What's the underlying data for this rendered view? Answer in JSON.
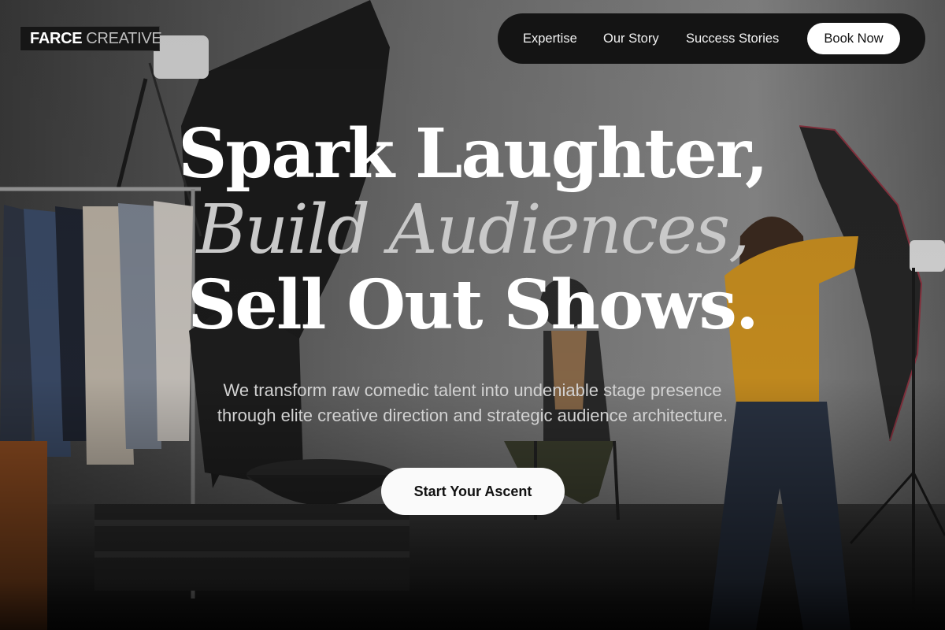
{
  "brand": {
    "logo_primary": "FARCE",
    "logo_secondary": "CREATIVE"
  },
  "nav": {
    "links": [
      "Expertise",
      "Our Story",
      "Success Stories"
    ],
    "cta": "Book Now"
  },
  "hero": {
    "line1": "Spark Laughter,",
    "line2": "Build Audiences,",
    "line3": "Sell Out Shows.",
    "description": "We transform raw comedic talent into undeniable stage presence through elite creative direction and strategic audience architecture.",
    "cta": "Start Your Ascent"
  },
  "colors": {
    "nav_bg": "#141414",
    "button_bg": "#ffffff",
    "headline": "#ffffff",
    "headline_italic": "#c9c9c9",
    "body_text": "#d2d2d2"
  }
}
